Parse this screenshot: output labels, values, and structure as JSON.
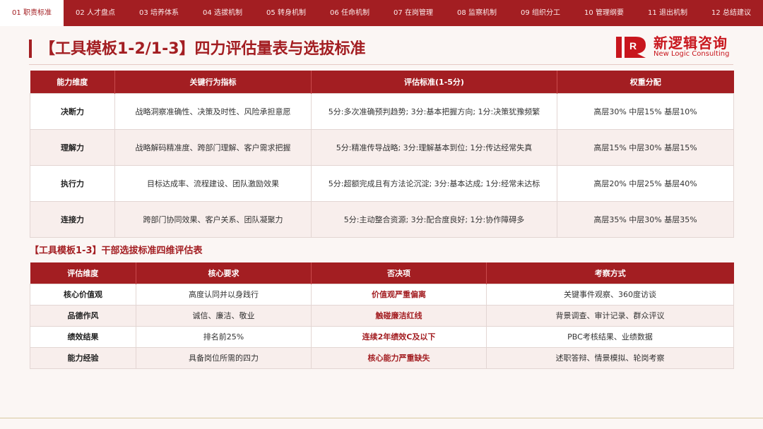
{
  "tabs": [
    "01 职责标准",
    "02 人才盘点",
    "03 培养体系",
    "04 选拔机制",
    "05 转身机制",
    "06 任命机制",
    "07 在岗管理",
    "08 监察机制",
    "09 组织分工",
    "10 管理纲要",
    "11 退出机制",
    "12 总结建议"
  ],
  "active_tab": 0,
  "title": "【工具模板1-2/1-3】四力评估量表与选拔标准",
  "logo": {
    "name_cn": "新逻辑咨询",
    "name_en": "New Logic Consulting",
    "mark_text": "R"
  },
  "table1": {
    "headers": [
      "能力维度",
      "关键行为指标",
      "评估标准(1-5分)",
      "权重分配"
    ],
    "rows": [
      {
        "dimension": "决断力",
        "indicators": "战略洞察准确性、决策及时性、风险承担意愿",
        "standard": "5分:多次准确预判趋势; 3分:基本把握方向; 1分:决策犹豫频繁",
        "weight": "高层30% 中层15% 基层10%"
      },
      {
        "dimension": "理解力",
        "indicators": "战略解码精准度、跨部门理解、客户需求把握",
        "standard": "5分:精准传导战略; 3分:理解基本到位; 1分:传达经常失真",
        "weight": "高层15% 中层30% 基层15%"
      },
      {
        "dimension": "执行力",
        "indicators": "目标达成率、流程建设、团队激励效果",
        "standard": "5分:超额完成且有方法论沉淀; 3分:基本达成; 1分:经常未达标",
        "weight": "高层20% 中层25% 基层40%"
      },
      {
        "dimension": "连接力",
        "indicators": "跨部门协同效果、客户关系、团队凝聚力",
        "standard": "5分:主动整合资源; 3分:配合度良好; 1分:协作障碍多",
        "weight": "高层35% 中层30% 基层35%"
      }
    ]
  },
  "subtitle": "【工具模板1-3】干部选拔标准四维评估表",
  "table2": {
    "headers": [
      "评估维度",
      "核心要求",
      "否决项",
      "考察方式"
    ],
    "rows": [
      {
        "dimension": "核心价值观",
        "requirement": "高度认同并以身践行",
        "veto": "价值观严重偏离",
        "method": "关键事件观察、360度访谈"
      },
      {
        "dimension": "品德作风",
        "requirement": "诚信、廉洁、敬业",
        "veto": "触碰廉洁红线",
        "method": "背景调查、审计记录、群众评议"
      },
      {
        "dimension": "绩效结果",
        "requirement": "排名前25%",
        "veto": "连续2年绩效C及以下",
        "method": "PBC考核结果、业绩数据"
      },
      {
        "dimension": "能力经验",
        "requirement": "具备岗位所需的四力",
        "veto": "核心能力严重缺失",
        "method": "述职答辩、情景模拟、轮岗考察"
      }
    ]
  },
  "colors": {
    "brand": "#a31e22",
    "logo": "#c8161d",
    "row_alt": "#f8eeec"
  }
}
